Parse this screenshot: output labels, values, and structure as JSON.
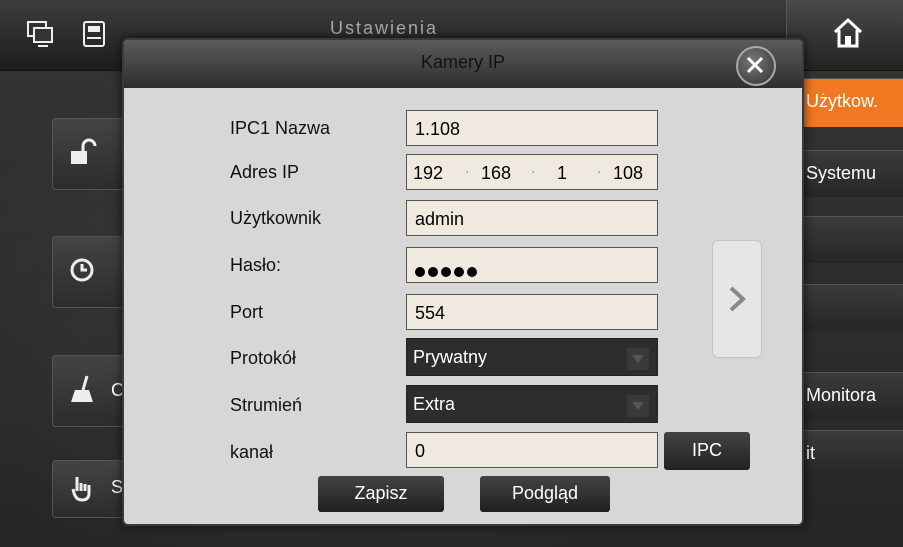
{
  "topbar": {
    "background_title": "Ustawienia",
    "icons": [
      "monitor-icon",
      "sd-card-icon",
      "home-icon"
    ]
  },
  "left_panel": {
    "items": [
      {
        "label": "",
        "icon": "unlock-icon"
      },
      {
        "label": "",
        "icon": "clock-icon"
      },
      {
        "label": "Cz",
        "icon": "broom-icon"
      },
      {
        "label": "Sy",
        "icon": "hand-pointer-icon"
      }
    ]
  },
  "right_tabs": [
    {
      "label": "Użytkow.",
      "active": true
    },
    {
      "label": "Systemu",
      "active": false
    },
    {
      "label": "",
      "active": false
    },
    {
      "label": "",
      "active": false
    },
    {
      "label": "Monitora",
      "active": false
    },
    {
      "label": "it",
      "active": false
    }
  ],
  "dialog": {
    "title": "Kamery IP",
    "fields": {
      "name": {
        "label": "IPC1 Nazwa",
        "value": "1.108"
      },
      "ip": {
        "label": "Adres IP",
        "octets": [
          "192",
          "168",
          "1",
          "108"
        ]
      },
      "user": {
        "label": "Użytkownik",
        "value": "admin"
      },
      "password": {
        "label": "Hasło:",
        "masked_length": 5
      },
      "port": {
        "label": "Port",
        "value": "554"
      },
      "protocol": {
        "label": "Protokół",
        "value": "Prywatny"
      },
      "stream": {
        "label": "Strumień",
        "value": "Extra"
      },
      "channel": {
        "label": "kanał",
        "value": "0"
      }
    },
    "ipc_button": "IPC",
    "save_button": "Zapisz",
    "preview_button": "Podgląd"
  },
  "colors": {
    "accent": "#f07820",
    "dialog_bg": "#d7d7d7",
    "input_bg": "#efe9e0",
    "dark_button": "#2d2d2d"
  }
}
